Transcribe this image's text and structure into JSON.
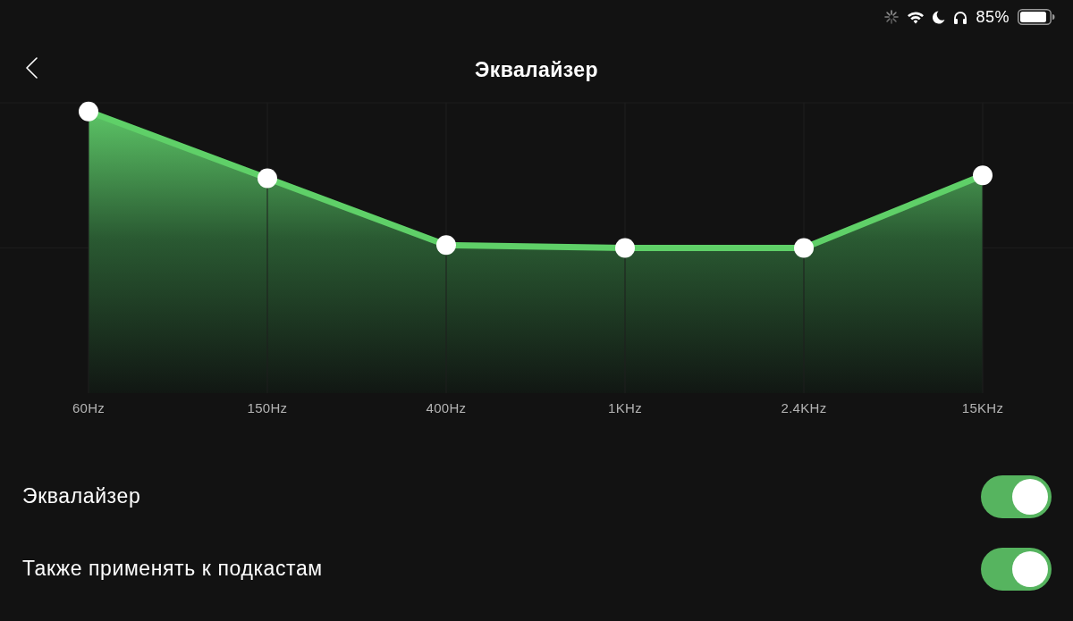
{
  "status_bar": {
    "battery": "85%"
  },
  "header": {
    "title": "Эквалайзер"
  },
  "equalizer": {
    "bands": [
      {
        "label": "60Hz",
        "level": 0.97
      },
      {
        "label": "150Hz",
        "level": 0.74
      },
      {
        "label": "400Hz",
        "level": 0.51
      },
      {
        "label": "1KHz",
        "level": 0.5
      },
      {
        "label": "2.4KHz",
        "level": 0.5
      },
      {
        "label": "15KHz",
        "level": 0.75
      }
    ]
  },
  "settings": [
    {
      "kind": "switch",
      "label": "Эквалайзер",
      "on": true
    },
    {
      "kind": "switch",
      "label": "Также применять к подкастам",
      "on": true
    }
  ]
}
